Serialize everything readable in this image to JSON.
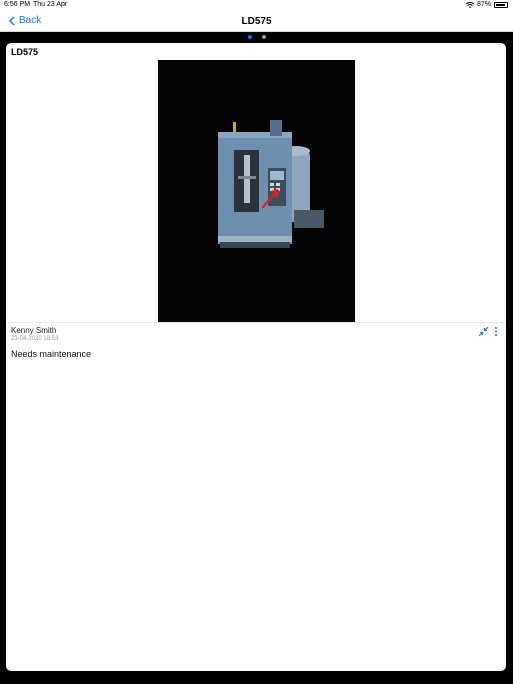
{
  "status_bar": {
    "time": "6:56 PM",
    "date": "Thu 23 Apr",
    "battery_percent": "87%",
    "battery_level": 0.87
  },
  "nav": {
    "back_label": "Back",
    "title": "LD575"
  },
  "pager": {
    "pages": 2,
    "current_page": 1
  },
  "card": {
    "title": "LD575",
    "photo_icon": "cnc-machine-photo",
    "author": "Kenny Smith",
    "timestamp": "23-04-2020 18:53",
    "comment": "Needs maintenance"
  },
  "colors": {
    "accent": "#1a73e8",
    "annotation": "#e02020",
    "machine": "#6f8fb0"
  }
}
